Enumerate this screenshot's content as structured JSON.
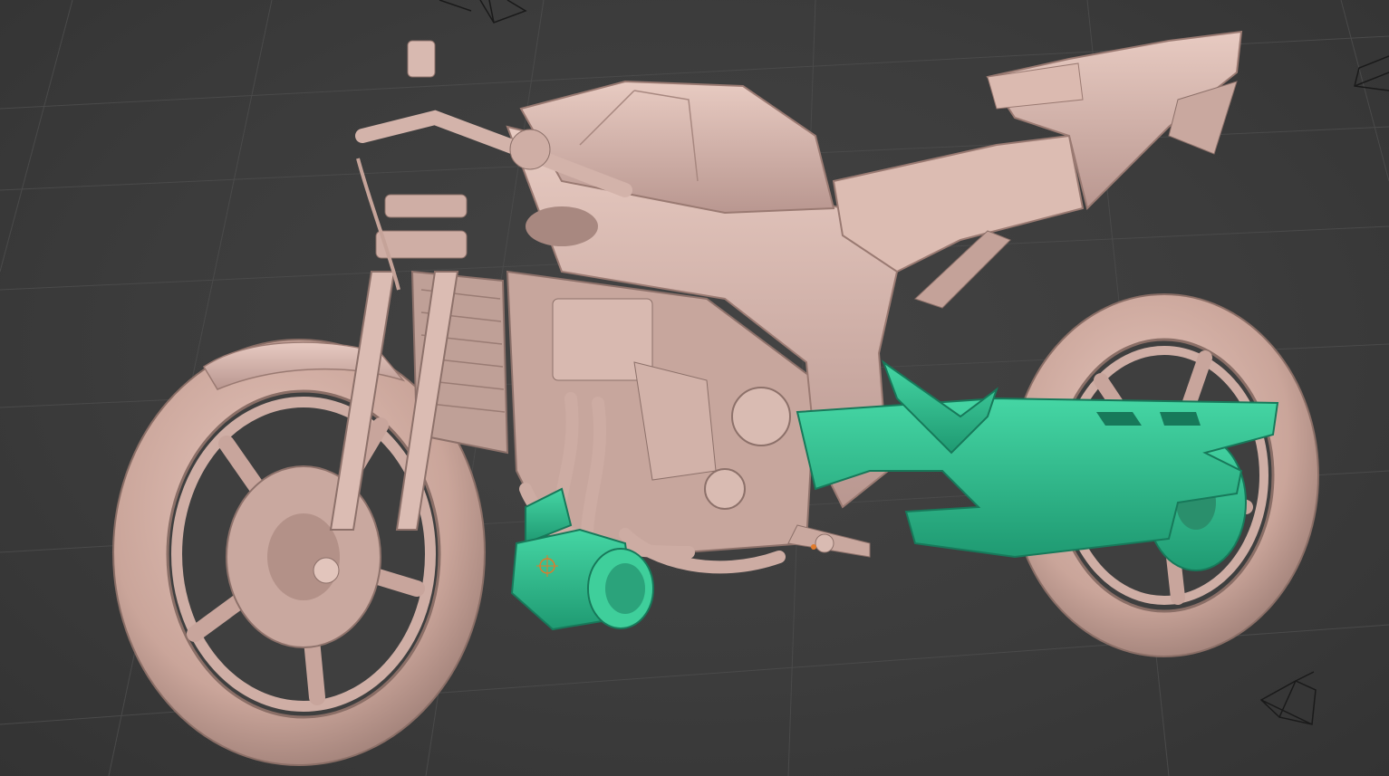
{
  "viewport": {
    "mode": "3d-sculpt-viewport",
    "background_color": "#3d3d3d",
    "grid_color": "#4a4a4a",
    "grid_visible": true
  },
  "scene": {
    "object": "motorcycle-model",
    "base_material_color": "#d8b5ab",
    "base_material_shadow": "#a88880",
    "selected_parts": [
      "exhaust-muffler",
      "swingarm",
      "subframe-linkage",
      "rear-sprocket"
    ],
    "selection_color": "#2fbf8f",
    "unselected_parts": [
      "front-wheel",
      "rear-wheel",
      "fork",
      "radiator",
      "engine",
      "fuel-tank",
      "seat",
      "tail",
      "frame",
      "front-fender"
    ]
  },
  "overlays": {
    "camera_icons": 3,
    "origin_marker": "object-origin-icon"
  }
}
